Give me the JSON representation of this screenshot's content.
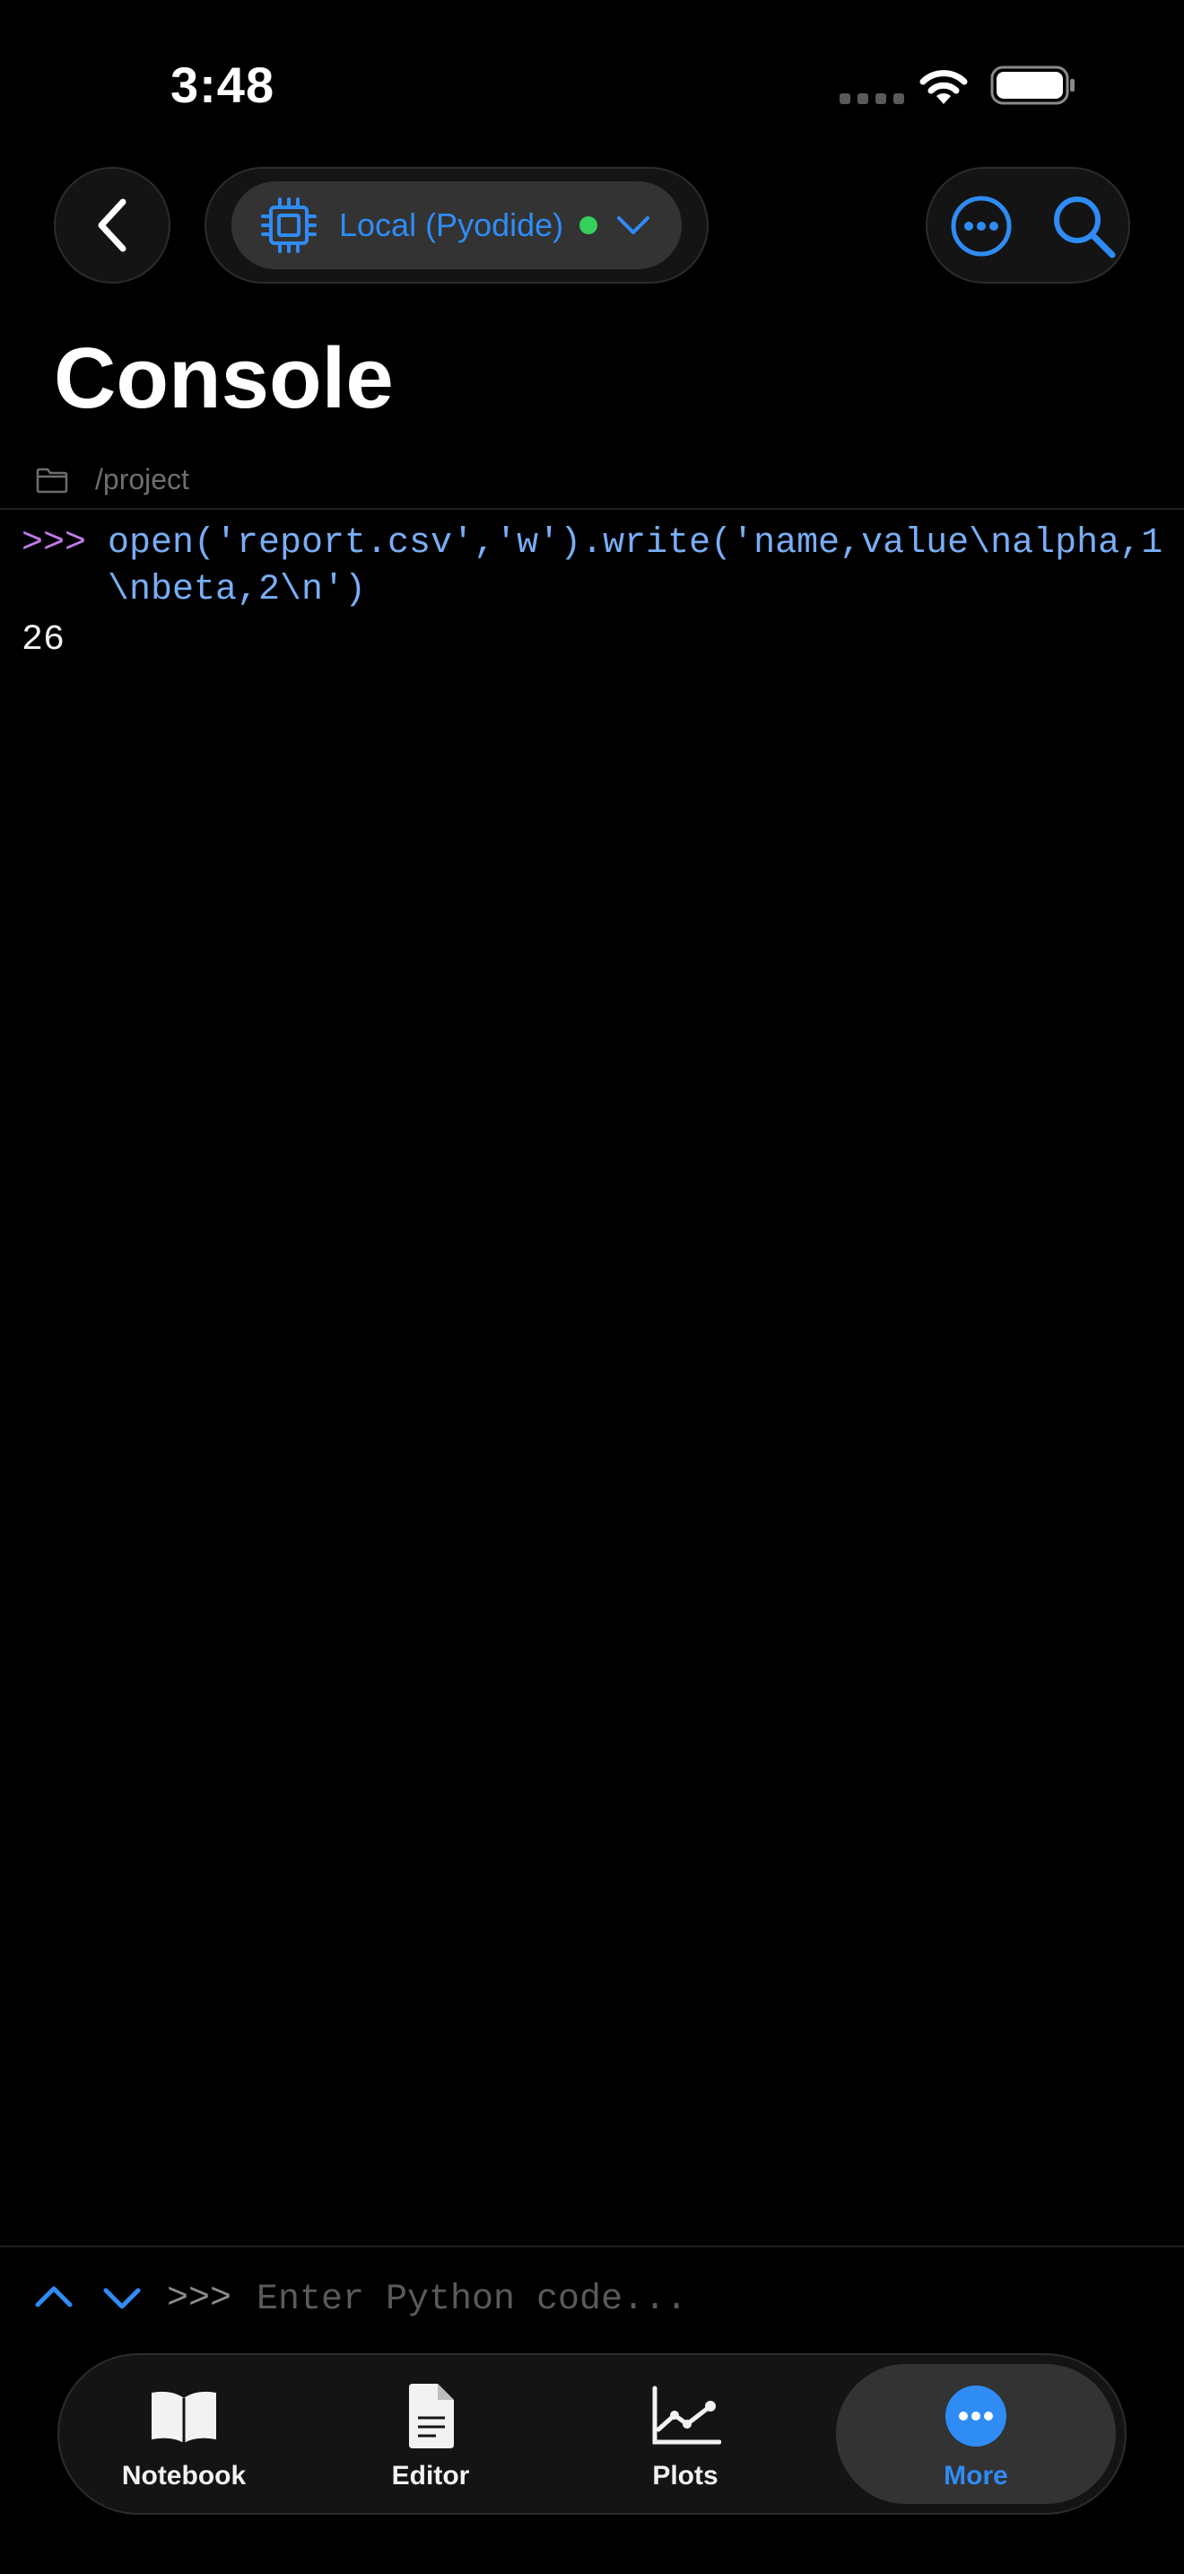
{
  "status_bar": {
    "time": "3:48"
  },
  "header": {
    "kernel_label": "Local (Pyodide)",
    "title": "Console"
  },
  "path": "/project",
  "console": {
    "prompt": ">>>",
    "input_code": "open('report.csv','w').write('name,value\\nalpha,1\\nbeta,2\\n')",
    "output": "26"
  },
  "input_bar": {
    "prompt": ">>>",
    "placeholder": "Enter Python code..."
  },
  "tabs": [
    {
      "label": "Notebook",
      "icon": "book-icon"
    },
    {
      "label": "Editor",
      "icon": "document-icon"
    },
    {
      "label": "Plots",
      "icon": "line-chart-icon"
    },
    {
      "label": "More",
      "icon": "ellipsis-circle-icon"
    }
  ],
  "colors": {
    "accent": "#2f8cf5",
    "status_online": "#35d05a",
    "prompt": "#c07be8",
    "code": "#79aef5"
  }
}
